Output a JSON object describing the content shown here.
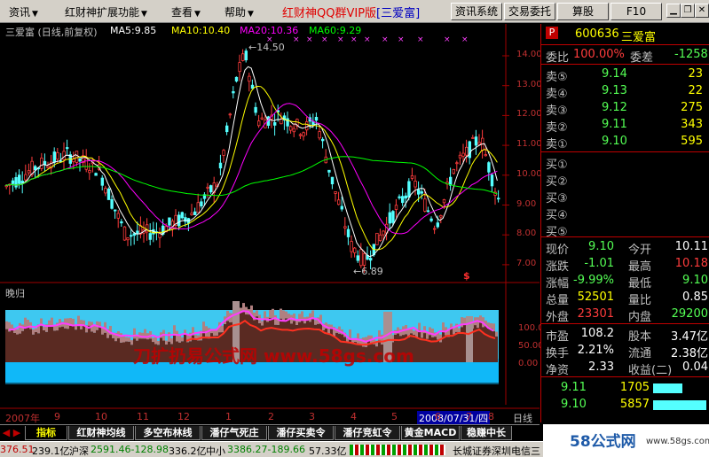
{
  "menu": {
    "items": [
      {
        "label": "资讯",
        "has_arrow": true
      },
      {
        "label": "红财神扩展功能",
        "has_arrow": true
      },
      {
        "label": "查看",
        "has_arrow": true
      },
      {
        "label": "帮助",
        "has_arrow": true
      }
    ],
    "title": "红财神QQ群VIP版",
    "title_bracket": "[三爱富]",
    "buttons": [
      "资讯系统",
      "交易委托",
      "算股",
      "F10"
    ]
  },
  "chart": {
    "header": "三爱富 (日线,前复权)",
    "ma5": "MA5:9.85",
    "ma10": "MA10:10.40",
    "ma20": "MA20:10.36",
    "ma60": "MA60:9.29",
    "high_label": "14.50",
    "low_label": "6.89",
    "signal_mark": "$",
    "lower_title": "晚归",
    "watermark": "刀扩扔易公式网  www.58gs.com",
    "date_label": "2008/07/31/四",
    "period_label": "日线",
    "price_axis": [
      "14.00",
      "13.00",
      "12.00",
      "11.00",
      "10.00",
      "9.00",
      "8.00",
      "7.00"
    ],
    "lower_axis": [
      "100.0",
      "50.00",
      "0.00"
    ],
    "x_ticks": [
      "2007年",
      "9",
      "10",
      "11",
      "12",
      "1",
      "2",
      "3",
      "4",
      "5",
      "6",
      "7",
      "8"
    ],
    "colors": {
      "up": "#ff3c3c",
      "down": "#54ffff",
      "ma5": "#ffffff",
      "ma10": "#ffff00",
      "ma20": "#ff00ff",
      "ma60": "#00ff00"
    }
  },
  "quote": {
    "code": "600636",
    "name": "三爱富",
    "wei_bi_label": "委比",
    "wei_bi": "100.00%",
    "wei_cha_label": "委差",
    "wei_cha": "-1258",
    "sell": [
      {
        "label": "卖⑤",
        "price": "9.14",
        "vol": "23"
      },
      {
        "label": "卖④",
        "price": "9.13",
        "vol": "22"
      },
      {
        "label": "卖③",
        "price": "9.12",
        "vol": "275"
      },
      {
        "label": "卖②",
        "price": "9.11",
        "vol": "343"
      },
      {
        "label": "卖①",
        "price": "9.10",
        "vol": "595"
      }
    ],
    "buy": [
      "买①",
      "买②",
      "买③",
      "买④",
      "买⑤"
    ],
    "stats": [
      {
        "l1": "现价",
        "v1": "9.10",
        "l2": "今开",
        "v2": "10.11"
      },
      {
        "l1": "涨跌",
        "v1": "-1.01",
        "l2": "最高",
        "v2": "10.18"
      },
      {
        "l1": "涨幅",
        "v1": "-9.99%",
        "l2": "最低",
        "v2": "9.10"
      },
      {
        "l1": "总量",
        "v1": "52501",
        "l2": "量比",
        "v2": "0.85"
      },
      {
        "l1": "外盘",
        "v1": "23301",
        "l2": "内盘",
        "v2": "29200"
      }
    ],
    "stats2": [
      {
        "l1": "市盈",
        "v1": "108.2",
        "l2": "股本",
        "v2": "3.47亿"
      },
      {
        "l1": "换手",
        "v1": "2.21%",
        "l2": "流通",
        "v2": "2.38亿"
      },
      {
        "l1": "净资",
        "v1": "2.33",
        "l2": "收益(二)",
        "v2": "0.04"
      }
    ],
    "ticks": [
      {
        "price": "9.11",
        "vol": "1705",
        "bar": 0.55
      },
      {
        "price": "9.10",
        "vol": "5857",
        "bar": 1.0
      }
    ]
  },
  "tabs": {
    "items": [
      "指标",
      "红财神均线",
      "多空布林线",
      "潘仔气死庄",
      "潘仔买卖令",
      "潘仔竞虹令",
      "黄金MACD",
      "稳赚中长"
    ],
    "more": "笔",
    "active": 0
  },
  "status": {
    "sh": "376.51",
    "sh_amt": "239.1亿",
    "sz_label": "沪深",
    "sz": "2591.46-128.98",
    "sz_amt": "336.2亿",
    "zx_label": "中小",
    "zx": "3386.27-189.66",
    "zx_amt": "57.33亿",
    "broker": "长城证券深圳电信三"
  },
  "logo": {
    "text": "58公式网",
    "url": "www.58gs.com"
  }
}
